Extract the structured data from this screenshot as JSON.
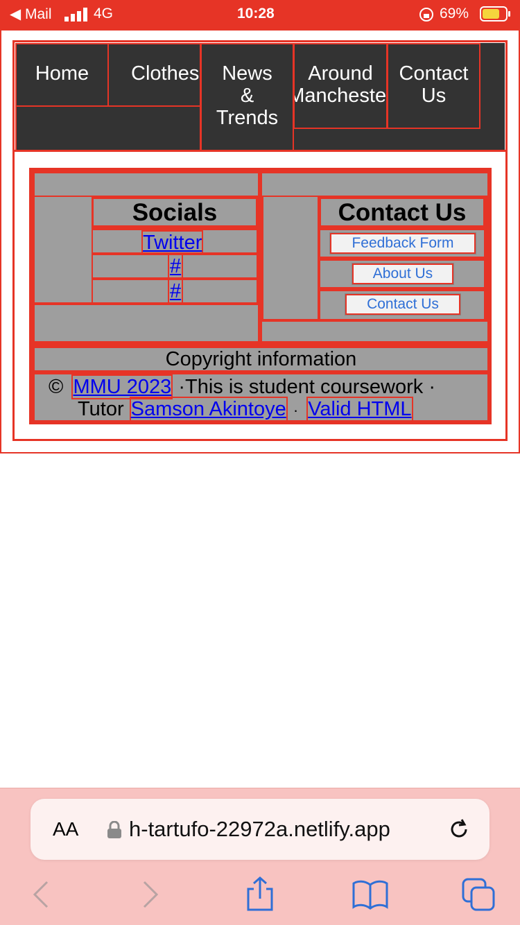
{
  "status_bar": {
    "back_label": "◀ Mail",
    "network": "4G",
    "time": "10:28",
    "battery": "69%"
  },
  "nav": {
    "items": [
      {
        "label": "Home"
      },
      {
        "label": "Clothes"
      },
      {
        "label": "News\n&\nTrends"
      },
      {
        "label": "Around\nManchester"
      },
      {
        "label": "Contact\nUs"
      }
    ]
  },
  "footer": {
    "socials": {
      "heading": "Socials",
      "links": [
        "Twitter",
        "#",
        "#"
      ]
    },
    "contact": {
      "heading": "Contact Us",
      "buttons": [
        "Feedback Form",
        "About Us",
        "Contact Us"
      ]
    },
    "copyright": {
      "heading": "Copyright information",
      "symbol": "©",
      "org_link": "MMU 2023",
      "text1": "·This is student coursework ·",
      "text2": "Tutor",
      "tutor_link": "Samson Akintoye",
      "sep": "·",
      "valid_link": "Valid HTML"
    }
  },
  "browser": {
    "text_size_label": "AA",
    "url": "h-tartufo-22972a.netlify.app"
  },
  "colors": {
    "accent": "#e63426",
    "nav_bg": "#333333",
    "footer_bg": "#9e9e9e",
    "link": "#0000ee"
  }
}
